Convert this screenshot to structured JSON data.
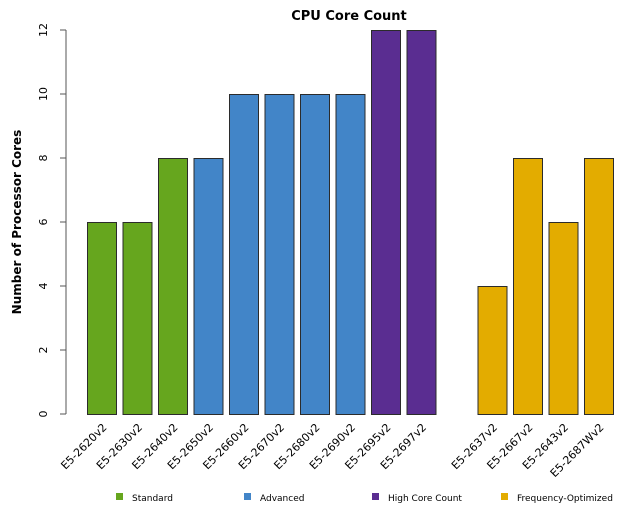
{
  "chart_data": {
    "type": "bar",
    "title": "CPU Core Count",
    "xlabel": "",
    "ylabel": "Number of Processor Cores",
    "ylim": [
      0,
      12
    ],
    "yticks": [
      0,
      2,
      4,
      6,
      8,
      10,
      12
    ],
    "grid": false,
    "legend_position": "bottom",
    "groups": [
      {
        "name": "Standard",
        "color": "#66a61e"
      },
      {
        "name": "Advanced",
        "color": "#4285c8"
      },
      {
        "name": "High Core Count",
        "color": "#5a2d91"
      },
      {
        "name": "Frequency-Optimized",
        "color": "#e3ac00"
      }
    ],
    "bars": [
      {
        "category": "E5-2620v2",
        "value": 6,
        "group": "Standard"
      },
      {
        "category": "E5-2630v2",
        "value": 6,
        "group": "Standard"
      },
      {
        "category": "E5-2640v2",
        "value": 8,
        "group": "Standard"
      },
      {
        "category": "E5-2650v2",
        "value": 8,
        "group": "Advanced"
      },
      {
        "category": "E5-2660v2",
        "value": 10,
        "group": "Advanced"
      },
      {
        "category": "E5-2670v2",
        "value": 10,
        "group": "Advanced"
      },
      {
        "category": "E5-2680v2",
        "value": 10,
        "group": "Advanced"
      },
      {
        "category": "E5-2690v2",
        "value": 10,
        "group": "Advanced"
      },
      {
        "category": "E5-2695v2",
        "value": 12,
        "group": "High Core Count"
      },
      {
        "category": "E5-2697v2",
        "value": 12,
        "group": "High Core Count"
      },
      {
        "category": "",
        "value": null,
        "group": null
      },
      {
        "category": "E5-2637v2",
        "value": 4,
        "group": "Frequency-Optimized"
      },
      {
        "category": "E5-2667v2",
        "value": 8,
        "group": "Frequency-Optimized"
      },
      {
        "category": "E5-2643v2",
        "value": 6,
        "group": "Frequency-Optimized"
      },
      {
        "category": "E5-2687Wv2",
        "value": 8,
        "group": "Frequency-Optimized"
      }
    ]
  }
}
